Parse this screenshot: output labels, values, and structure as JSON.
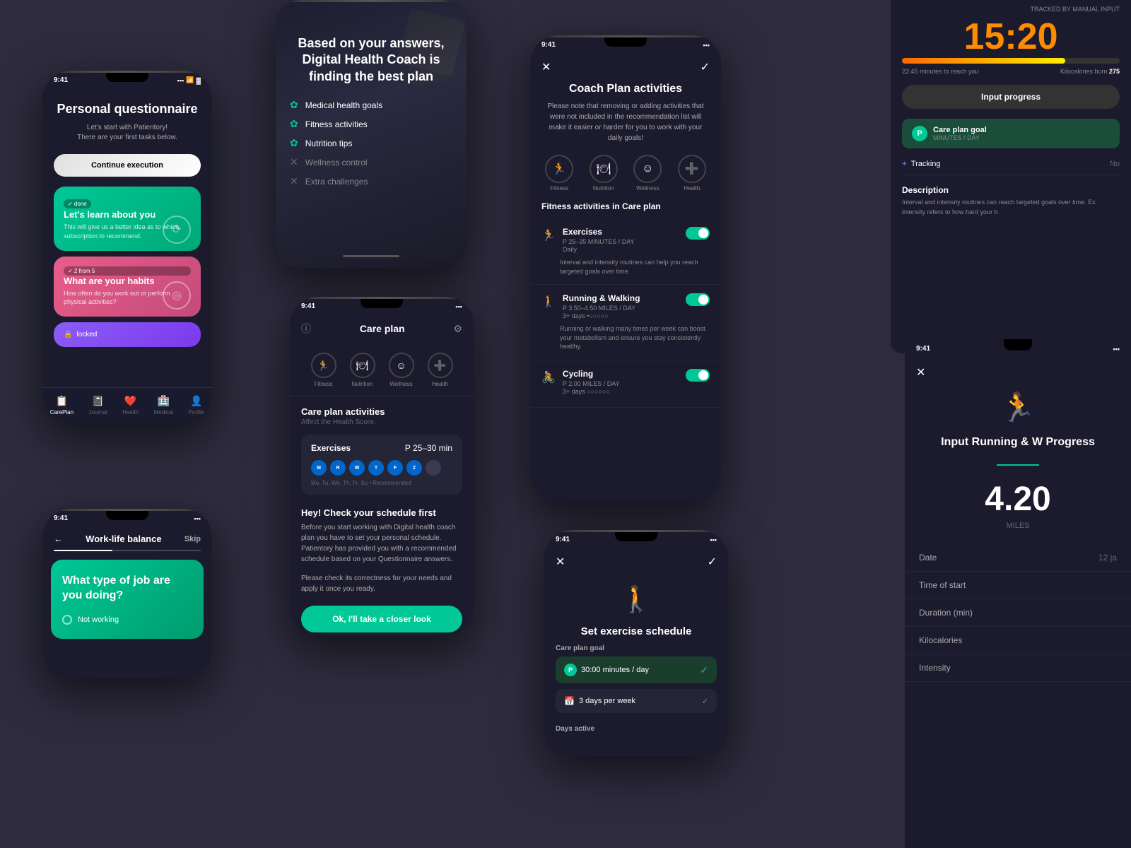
{
  "phone1": {
    "status_time": "9:41",
    "title": "Personal questionnaire",
    "subtitle": "Let's start with Patientory!\nThere are your first tasks below.",
    "cta_btn": "Continue execution",
    "card1": {
      "badge": "✓ done",
      "title": "Let's learn about you",
      "desc": "This will give us a better idea as to which subscription to recommend."
    },
    "card2": {
      "badge": "✓ 2 from 5",
      "title": "What are your habits",
      "desc": "How often do you work out or perform physical activities?"
    },
    "card3": {
      "badge": "locked"
    },
    "nav": {
      "items": [
        "CarePlan",
        "Journal",
        "Health",
        "Medical",
        "Profile"
      ]
    }
  },
  "phone2": {
    "status_time": "9:41",
    "header": "Work-life balance",
    "skip": "Skip",
    "question": "What type of job are you doing?",
    "option": "Not working"
  },
  "phone3": {
    "title": "Based on your answers, Digital Health Coach is finding the best plan",
    "items": [
      {
        "label": "Medical health goals",
        "active": true
      },
      {
        "label": "Fitness activities",
        "active": true
      },
      {
        "label": "Nutrition tips",
        "active": true
      },
      {
        "label": "Wellness control",
        "active": false
      },
      {
        "label": "Extra challenges",
        "active": false
      }
    ]
  },
  "phone4": {
    "status_time": "9:41",
    "header_title": "Care plan",
    "icons": [
      "Fitness",
      "Nutrition",
      "Wellness",
      "Health"
    ],
    "section_title": "Care plan activities",
    "section_sub": "Affect the Health Score.",
    "exercise": {
      "name": "Exercises",
      "time": "P 25–30 min",
      "days": [
        "M",
        "R",
        "W",
        "T",
        "F",
        "Z",
        ""
      ],
      "days_active": [
        true,
        true,
        true,
        true,
        true,
        true,
        false
      ],
      "day_label": "Mo, Tu, We, Th, Fr, Su  •  Recommended"
    },
    "check_title": "Hey! Check your schedule first",
    "check_desc": "Before you start working with Digital health coach plan you have to set your personal schedule. Patientory has provided you with a recommended schedule based on your Questionnaire answers.",
    "check_desc2": "Please check its correctness for your needs and apply it once you ready.",
    "check_btn": "Ok, I'll take a closer look"
  },
  "phone5": {
    "status_time": "9:41",
    "title": "Coach Plan activities",
    "desc": "Please note that removing or adding activities that were not included in the recommendation list will make it easier or harder for you to work with your daily goals!",
    "tabs": [
      "Fitness",
      "Nutrition",
      "Wellness",
      "Health"
    ],
    "section": "Fitness activities in Care plan",
    "activities": [
      {
        "icon": "🏃",
        "name": "Exercises",
        "range": "P 25–35 MINUTES / DAY",
        "freq": "Daily",
        "desc": "Interval and intensity routines can help you reach targeted goals over time.",
        "toggle": true
      },
      {
        "icon": "🚶",
        "name": "Running & Walking",
        "range": "P 3.50–4.50 MILES / DAY",
        "freq": "3+ days •○○○○○",
        "desc": "Running or walking many times per week can boost your metabolism and ensure you stay consistently healthy.",
        "toggle": true
      },
      {
        "icon": "🚴",
        "name": "Cycling",
        "range": "P 2.00 MILES / DAY",
        "freq": "3+ days ○○○○○○",
        "desc": "",
        "toggle": true
      }
    ]
  },
  "phone6": {
    "status_time": "9:41",
    "title": "Set exercise schedule",
    "goal_label": "Care plan goal",
    "goal_time": "30:00 minutes / day",
    "goal_freq": "3 days per week",
    "days_label": "Days active"
  },
  "panel_right": {
    "tracked_label": "TRACKED BY MANUAL INPUT",
    "time": "15:20",
    "minutes_to_reach": "22:45 minutes to reach you",
    "kcal_label": "Kilocalories burn",
    "kcal_value": "275",
    "input_btn": "Input progress",
    "goal_title": "Care plan goal",
    "goal_sub": "MINUTES / DAY",
    "tracking_label": "Tracking",
    "tracking_val": "No",
    "description_title": "Description",
    "description_text": "Interval and intensity routines can reach targeted goals over time. Ex intensity refers to how hard your b"
  },
  "panel_right2": {
    "status_time": "9:41",
    "title": "Input Running & W Progress",
    "value": "4.20",
    "unit": "MILES",
    "form_rows": [
      {
        "label": "Date",
        "value": "12 ja"
      },
      {
        "label": "Time of start",
        "value": ""
      },
      {
        "label": "Duration (min)",
        "value": ""
      },
      {
        "label": "Kilocalories",
        "value": ""
      },
      {
        "label": "Intensity",
        "value": ""
      }
    ]
  }
}
